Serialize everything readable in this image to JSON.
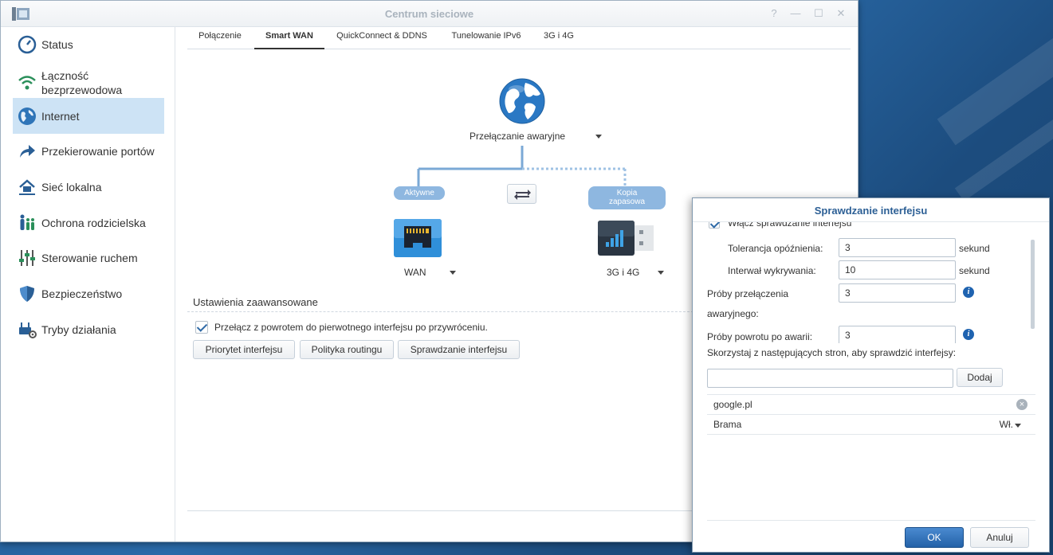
{
  "window": {
    "title": "Centrum sieciowe"
  },
  "title_controls": {
    "help": "?",
    "minimize": "—",
    "maximize": "☐",
    "close": "✕"
  },
  "sidebar": {
    "items": [
      {
        "label": "Status",
        "icon": "gauge-icon"
      },
      {
        "label": "Łączność bezprzewodowa",
        "icon": "wifi-icon"
      },
      {
        "label": "Internet",
        "icon": "globe-icon",
        "active": true
      },
      {
        "label": "Przekierowanie portów",
        "icon": "forward-arrow-icon"
      },
      {
        "label": "Sieć lokalna",
        "icon": "home-network-icon"
      },
      {
        "label": "Ochrona rodzicielska",
        "icon": "family-icon"
      },
      {
        "label": "Sterowanie ruchem",
        "icon": "sliders-icon"
      },
      {
        "label": "Bezpieczeństwo",
        "icon": "shield-icon"
      },
      {
        "label": "Tryby działania",
        "icon": "router-gear-icon"
      }
    ]
  },
  "tabs": [
    {
      "label": "Połączenie"
    },
    {
      "label": "Smart WAN",
      "active": true
    },
    {
      "label": "QuickConnect & DDNS"
    },
    {
      "label": "Tunelowanie IPv6"
    },
    {
      "label": "3G i 4G"
    }
  ],
  "smart_wan": {
    "mode": "Przełączanie awaryjne",
    "active_badge": "Aktywne",
    "backup_badge_line1": "Kopia",
    "backup_badge_line2": "zapasowa",
    "primary_interface": "WAN",
    "backup_interface": "3G i 4G"
  },
  "advanced": {
    "title": "Ustawienia zaawansowane",
    "switch_back_label": "Przełącz z powrotem do pierwotnego interfejsu po przywróceniu.",
    "switch_back_checked": true,
    "buttons": {
      "priority": "Priorytet interfejsu",
      "routing": "Polityka routingu",
      "check": "Sprawdzanie interfejsu"
    }
  },
  "dialog": {
    "title": "Sprawdzanie interfejsu",
    "enable_label": "Włącz sprawdzanie interfejsu",
    "enable_checked": true,
    "latency_label": "Tolerancja opóźnienia:",
    "latency_value": "3",
    "latency_unit": "sekund",
    "interval_label": "Interwał wykrywania:",
    "interval_value": "10",
    "interval_unit": "sekund",
    "failover_label_line1": "Próby przełączenia",
    "failover_label_line2": "awaryjnego:",
    "failover_value": "3",
    "failback_label": "Próby powrotu po awarii:",
    "failback_value": "3",
    "sites_label": "Skorzystaj z następujących stron, aby sprawdzić interfejsy:",
    "site_input_value": "",
    "add_label": "Dodaj",
    "sites": [
      {
        "name": "google.pl"
      }
    ],
    "gateway_label": "Brama",
    "gateway_value": "Wł.",
    "ok_label": "OK",
    "cancel_label": "Anuluj"
  },
  "colors": {
    "accent": "#2462a8",
    "active_nav": "#cde3f5",
    "badge": "#8eb7e0"
  }
}
